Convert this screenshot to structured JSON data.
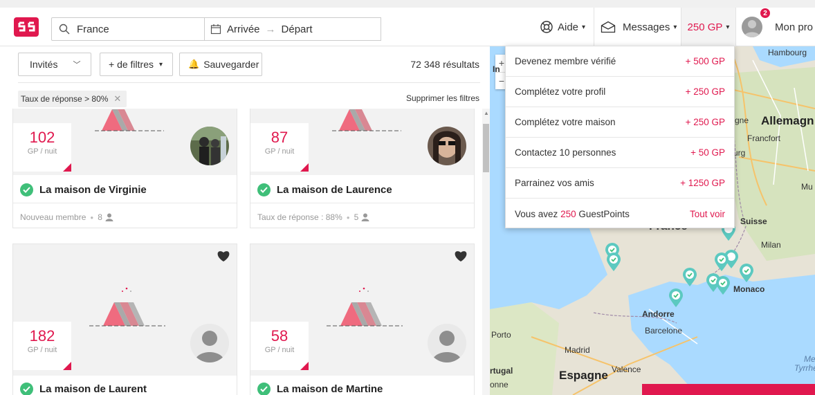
{
  "header": {
    "search_value": "France",
    "arrival": "Arrivée",
    "arrow": "→",
    "departure": "Départ",
    "help": "Aide",
    "messages": "Messages",
    "guestpoints": "250 GP",
    "notif_count": "2",
    "profile": "Mon pro"
  },
  "filters": {
    "guests": "Invités",
    "more_filters": "+ de filtres",
    "save": "Sauvegarder",
    "results": "72 348 résultats",
    "active_tag": "Taux de réponse > 80%",
    "clear": "Supprimer les filtres"
  },
  "listings": [
    {
      "price": "102",
      "unit": "GP / nuit",
      "title": "La maison de Virginie",
      "meta": "Nouveau membre",
      "guests": "8"
    },
    {
      "price": "87",
      "unit": "GP / nuit",
      "title": "La maison de Laurence",
      "meta": "Taux de réponse : 88%",
      "guests": "5"
    },
    {
      "price": "182",
      "unit": "GP / nuit",
      "title": "La maison de Laurent"
    },
    {
      "price": "58",
      "unit": "GP / nuit",
      "title": "La maison de Martine"
    }
  ],
  "dropdown": {
    "items": [
      {
        "label": "Devenez membre vérifié",
        "points": "+ 500 GP"
      },
      {
        "label": "Complétez votre profil",
        "points": "+ 250 GP"
      },
      {
        "label": "Complétez votre maison",
        "points": "+ 250 GP"
      },
      {
        "label": "Contactez 10 personnes",
        "points": "+ 50 GP"
      },
      {
        "label": "Parrainez vos amis",
        "points": "+ 1250 GP"
      }
    ],
    "footer_prefix": "Vous avez",
    "footer_amount": "250",
    "footer_suffix": "GuestPoints",
    "see_all": "Tout voir"
  },
  "map": {
    "labels": [
      "Hambourg",
      "Allemagn",
      "Francfort",
      "urg",
      "Mu",
      "Suisse",
      "Milan",
      "France",
      "Monaco",
      "Andorre",
      "Barcelone",
      "Porto",
      "Madrid",
      "Espagne",
      "Valence",
      "rtugal",
      "onne",
      "Me",
      "Tyrrhén",
      "gne",
      "In"
    ]
  },
  "colors": {
    "accent": "#e0184e",
    "verified": "#3fbf79",
    "pin": "#5cc9c0"
  }
}
